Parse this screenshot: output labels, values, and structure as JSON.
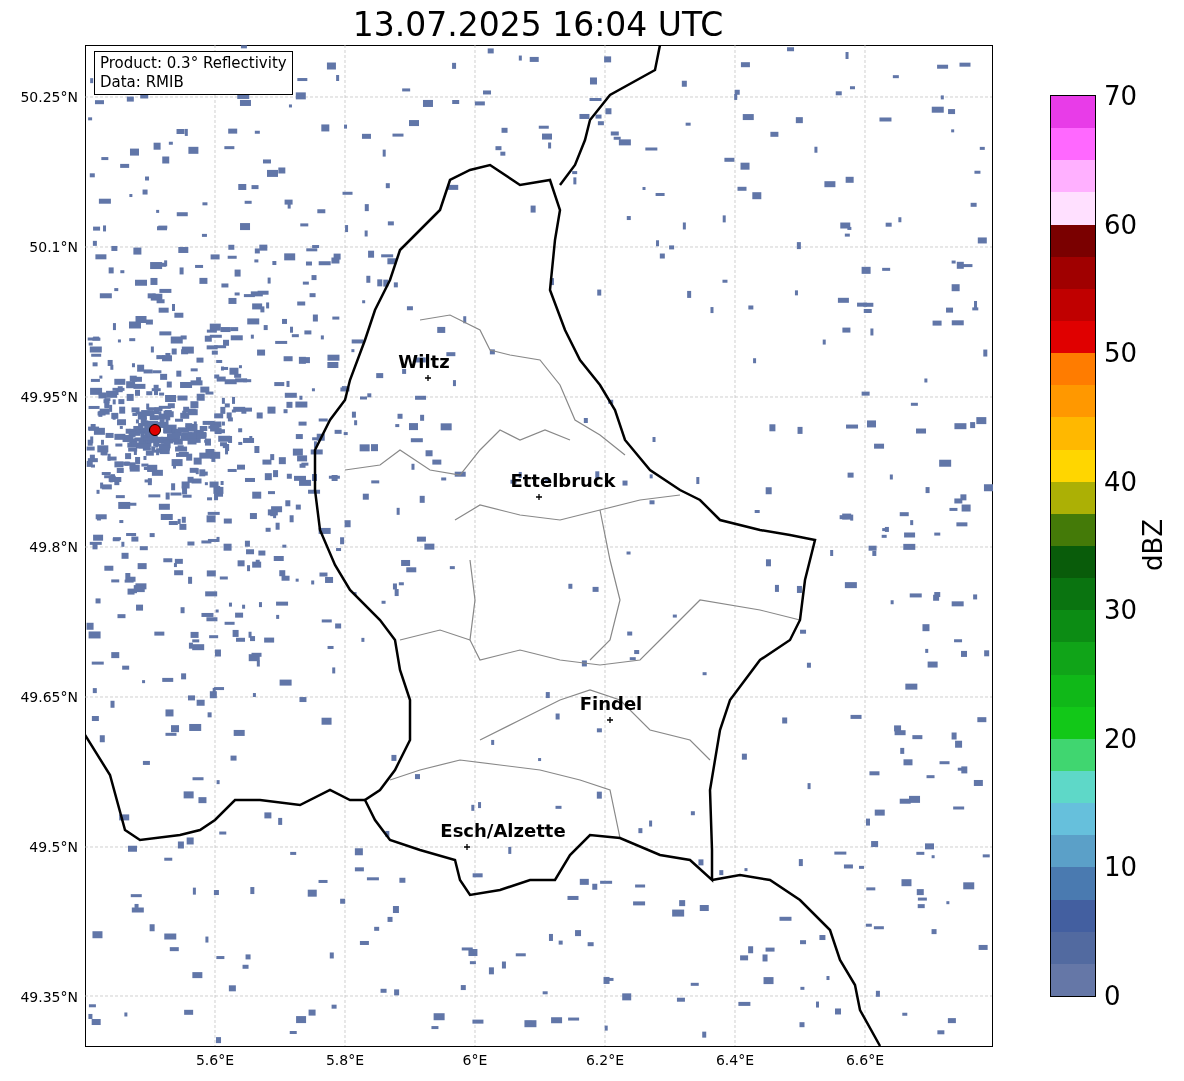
{
  "title": "13.07.2025 16:04 UTC",
  "info_box": {
    "lines": [
      "Product: 0.3° Reflectivity",
      "Data: RMIB"
    ]
  },
  "y_ticks": [
    "50.25°N",
    "50.1°N",
    "49.95°N",
    "49.8°N",
    "49.65°N",
    "49.5°N",
    "49.35°N"
  ],
  "x_ticks": [
    "5.6°E",
    "5.8°E",
    "6°E",
    "6.2°E",
    "6.4°E",
    "6.6°E"
  ],
  "cities": [
    {
      "name": "Wiltz"
    },
    {
      "name": "Ettelbruck"
    },
    {
      "name": "Findel"
    },
    {
      "name": "Esch/Alzette"
    }
  ],
  "colorbar": {
    "label": "dBZ",
    "ticks": [
      "70",
      "60",
      "50",
      "40",
      "30",
      "20",
      "10",
      "0"
    ],
    "segments": [
      {
        "color": "#6577a7"
      },
      {
        "color": "#526aa0"
      },
      {
        "color": "#435fa0"
      },
      {
        "color": "#4a7ab0"
      },
      {
        "color": "#5ba0c8"
      },
      {
        "color": "#66c0dc"
      },
      {
        "color": "#5ed8c8"
      },
      {
        "color": "#40d670"
      },
      {
        "color": "#12c818"
      },
      {
        "color": "#10b818"
      },
      {
        "color": "#10a418"
      },
      {
        "color": "#0c8c14"
      },
      {
        "color": "#0a7410"
      },
      {
        "color": "#095c0a"
      },
      {
        "color": "#447a08"
      },
      {
        "color": "#acb005"
      },
      {
        "color": "#ffd600"
      },
      {
        "color": "#ffb800"
      },
      {
        "color": "#ff9800"
      },
      {
        "color": "#ff7c00"
      },
      {
        "color": "#e00000"
      },
      {
        "color": "#c00000"
      },
      {
        "color": "#a00000"
      },
      {
        "color": "#7a0000"
      },
      {
        "color": "#ffe0ff"
      },
      {
        "color": "#ffb0ff"
      },
      {
        "color": "#ff68ff"
      },
      {
        "color": "#e83ce8"
      }
    ]
  }
}
